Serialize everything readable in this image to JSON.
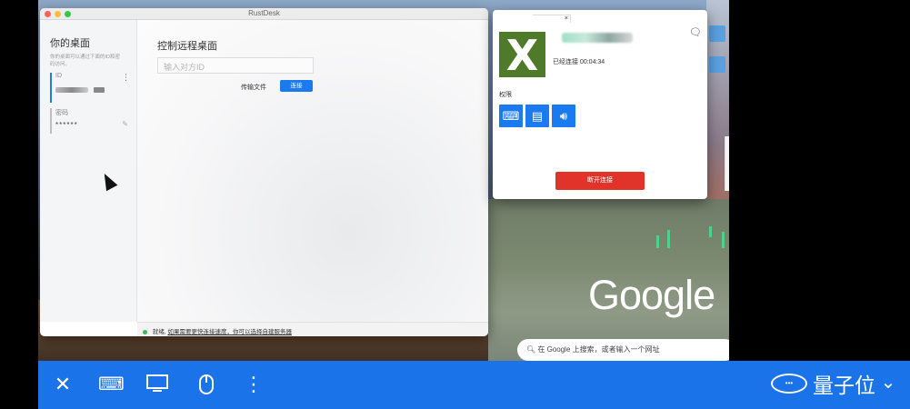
{
  "main_window": {
    "title": "RustDesk",
    "left": {
      "heading": "你的桌面",
      "desc": "你的桌面可以通过下面的ID和密码访问。",
      "id_label": "ID",
      "password_label": "密码",
      "password_value": "******"
    },
    "right": {
      "heading": "控制远程桌面",
      "id_input_placeholder": "输入对方ID",
      "transfer_label": "传输文件",
      "connect_label": "连接"
    },
    "status": {
      "ready_text": "就绪,",
      "link_text": "如果需要更快连接速度，你可以选择自建服务器"
    }
  },
  "connection_manager": {
    "tab_close": "×",
    "avatar_letter": "X",
    "status_text": "已经连接 00:04:34",
    "permissions_label": "权限",
    "disconnect_label": "断开连接",
    "permission_icons": [
      "keyboard-icon",
      "clipboard-icon",
      "speaker-icon"
    ]
  },
  "browser": {
    "logo_text": "Google",
    "search_placeholder": "在 Google 上搜索，或者输入一个网址"
  },
  "watermark": {
    "text": "量子位"
  },
  "toolbar": {
    "close_glyph": "✕",
    "more_glyph": "⋮",
    "collapse_glyph": "⌄"
  },
  "colors": {
    "accent_blue": "#1a7af0",
    "toolbar_blue": "#1a73e8",
    "danger_red": "#e0342a",
    "avatar_green": "#4f7a2a"
  }
}
